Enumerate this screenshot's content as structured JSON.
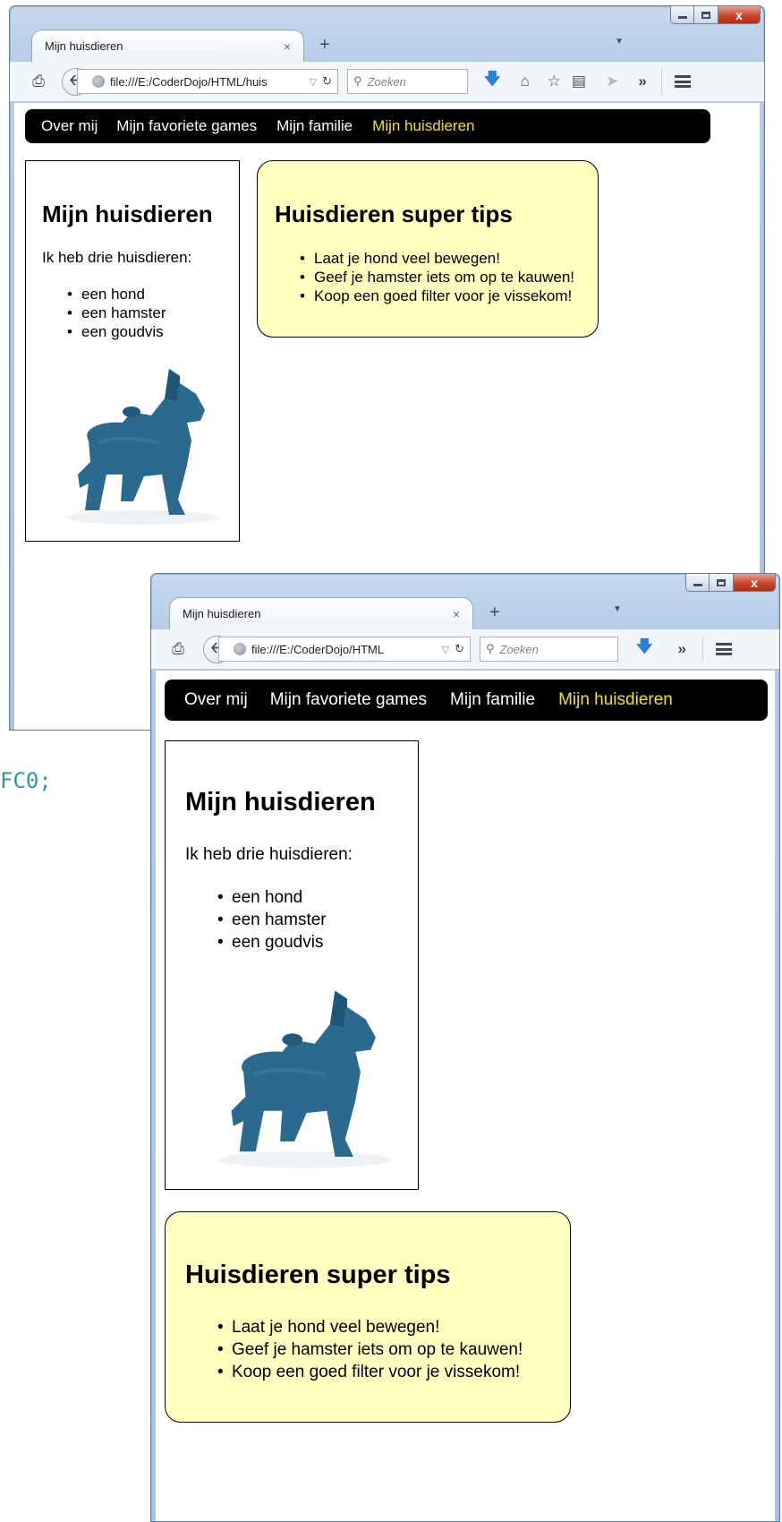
{
  "snippet": {
    "text": "FC0;"
  },
  "browser": {
    "tab_title": "Mijn huisdieren",
    "tab_close": "×",
    "new_tab": "+",
    "tab_list": "▼",
    "url_large": "file:///E:/CoderDojo/HTML/huis",
    "url_small": "file:///E:/CoderDojo/HTML",
    "search_placeholder": "Zoeken",
    "overflow": "»",
    "window_close": "x"
  },
  "site": {
    "nav": [
      "Over mij",
      "Mijn favoriete games",
      "Mijn familie",
      "Mijn huisdieren"
    ],
    "active_nav_index": 3,
    "pets": {
      "title": "Mijn huisdieren",
      "intro": "Ik heb drie huisdieren:",
      "items": [
        "een hond",
        "een hamster",
        "een goudvis"
      ]
    },
    "tips": {
      "title": "Huisdieren super tips",
      "items": [
        "Laat je hond veel bewegen!",
        "Geef je hamster iets om op te kauwen!",
        "Koop een goed filter voor je vissekom!"
      ]
    }
  },
  "colors": {
    "nav_background": "#000000",
    "nav_text": "#ffffff",
    "nav_active": "#f2e11f",
    "tips_background": "#ffffc0",
    "dog": "#2b6a8e"
  },
  "icons": [
    "print-icon",
    "back-arrow-icon",
    "globe-icon",
    "reload-icon",
    "search-icon",
    "download-icon",
    "home-icon",
    "bookmark-star-icon",
    "reading-list-icon",
    "share-icon",
    "overflow-icon",
    "menu-icon"
  ]
}
